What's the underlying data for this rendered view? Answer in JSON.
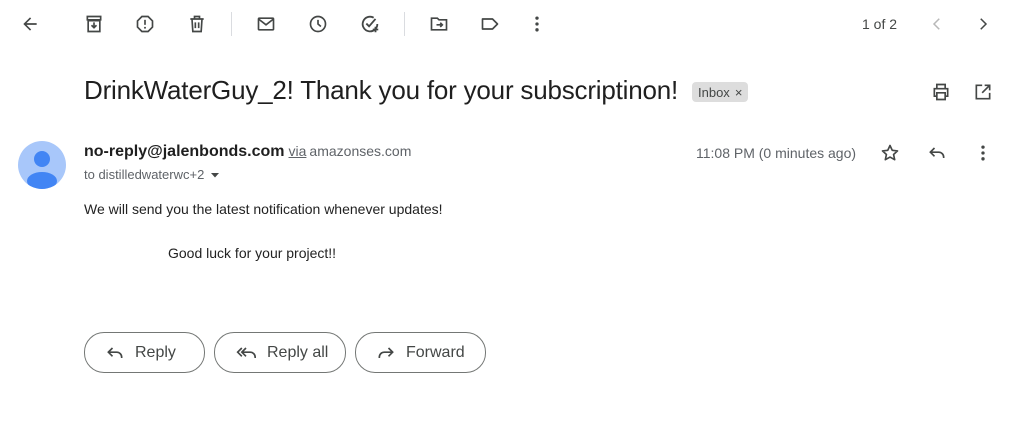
{
  "toolbar": {
    "icons": [
      "back-arrow-icon",
      "archive-icon",
      "report-spam-icon",
      "delete-icon",
      "mark-unread-icon",
      "snooze-icon",
      "add-to-tasks-icon",
      "move-to-icon",
      "labels-icon",
      "more-vert-icon"
    ]
  },
  "pager": {
    "text": "1 of 2"
  },
  "message": {
    "subject": "DrinkWaterGuy_2! Thank you for your subscriptinon!",
    "label": "Inbox",
    "label_close": "×",
    "sender_email": "no-reply@jalenbonds.com",
    "via": "via",
    "via_domain": "amazonses.com",
    "to": "to distilledwaterwc+2",
    "time": "11:08 PM (0 minutes ago)",
    "body_line1": "We will send you the latest notification whenever updates!",
    "body_line2": "Good luck for your project!!"
  },
  "actions": {
    "reply": "Reply",
    "reply_all": "Reply all",
    "forward": "Forward"
  },
  "colors": {
    "avatar_bg": "#a8c7fa",
    "avatar_fg": "#4285f4",
    "icon": "#444746"
  }
}
